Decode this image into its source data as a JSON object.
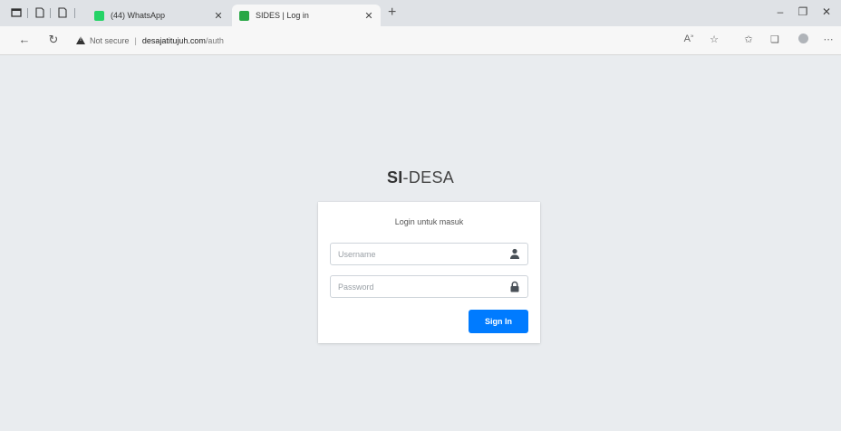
{
  "browser": {
    "tabs": [
      {
        "title": "(44) WhatsApp",
        "active": false,
        "favicon_color": "#25d366"
      },
      {
        "title": "SIDES | Log in",
        "active": true,
        "favicon_color": "#28a745"
      }
    ],
    "address": {
      "security_label": "Not secure",
      "host": "desajatitujuh.com",
      "path": "/auth"
    },
    "toolbar_icons": [
      "read-aloud-icon",
      "add-favorite-icon",
      "favorites-icon",
      "collections-icon",
      "profile-icon",
      "more-icon"
    ]
  },
  "page": {
    "brand_bold": "SI",
    "brand_rest": "-DESA",
    "login_message": "Login untuk masuk",
    "username_placeholder": "Username",
    "password_placeholder": "Password",
    "signin_label": "Sign In",
    "accent_color": "#007bff"
  }
}
